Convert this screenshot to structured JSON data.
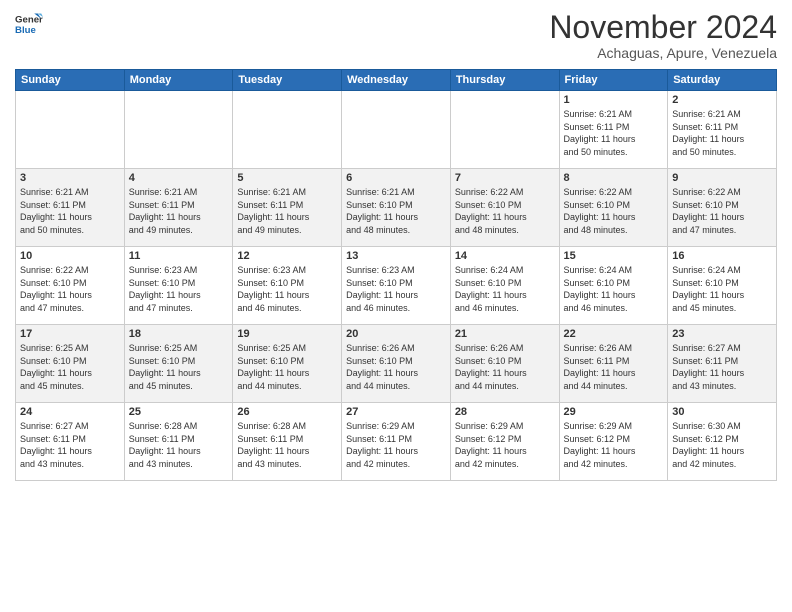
{
  "logo": {
    "line1": "General",
    "line2": "Blue"
  },
  "title": "November 2024",
  "location": "Achaguas, Apure, Venezuela",
  "days_header": [
    "Sunday",
    "Monday",
    "Tuesday",
    "Wednesday",
    "Thursday",
    "Friday",
    "Saturday"
  ],
  "weeks": [
    [
      {
        "day": "",
        "info": ""
      },
      {
        "day": "",
        "info": ""
      },
      {
        "day": "",
        "info": ""
      },
      {
        "day": "",
        "info": ""
      },
      {
        "day": "",
        "info": ""
      },
      {
        "day": "1",
        "info": "Sunrise: 6:21 AM\nSunset: 6:11 PM\nDaylight: 11 hours\nand 50 minutes."
      },
      {
        "day": "2",
        "info": "Sunrise: 6:21 AM\nSunset: 6:11 PM\nDaylight: 11 hours\nand 50 minutes."
      }
    ],
    [
      {
        "day": "3",
        "info": "Sunrise: 6:21 AM\nSunset: 6:11 PM\nDaylight: 11 hours\nand 50 minutes."
      },
      {
        "day": "4",
        "info": "Sunrise: 6:21 AM\nSunset: 6:11 PM\nDaylight: 11 hours\nand 49 minutes."
      },
      {
        "day": "5",
        "info": "Sunrise: 6:21 AM\nSunset: 6:11 PM\nDaylight: 11 hours\nand 49 minutes."
      },
      {
        "day": "6",
        "info": "Sunrise: 6:21 AM\nSunset: 6:10 PM\nDaylight: 11 hours\nand 48 minutes."
      },
      {
        "day": "7",
        "info": "Sunrise: 6:22 AM\nSunset: 6:10 PM\nDaylight: 11 hours\nand 48 minutes."
      },
      {
        "day": "8",
        "info": "Sunrise: 6:22 AM\nSunset: 6:10 PM\nDaylight: 11 hours\nand 48 minutes."
      },
      {
        "day": "9",
        "info": "Sunrise: 6:22 AM\nSunset: 6:10 PM\nDaylight: 11 hours\nand 47 minutes."
      }
    ],
    [
      {
        "day": "10",
        "info": "Sunrise: 6:22 AM\nSunset: 6:10 PM\nDaylight: 11 hours\nand 47 minutes."
      },
      {
        "day": "11",
        "info": "Sunrise: 6:23 AM\nSunset: 6:10 PM\nDaylight: 11 hours\nand 47 minutes."
      },
      {
        "day": "12",
        "info": "Sunrise: 6:23 AM\nSunset: 6:10 PM\nDaylight: 11 hours\nand 46 minutes."
      },
      {
        "day": "13",
        "info": "Sunrise: 6:23 AM\nSunset: 6:10 PM\nDaylight: 11 hours\nand 46 minutes."
      },
      {
        "day": "14",
        "info": "Sunrise: 6:24 AM\nSunset: 6:10 PM\nDaylight: 11 hours\nand 46 minutes."
      },
      {
        "day": "15",
        "info": "Sunrise: 6:24 AM\nSunset: 6:10 PM\nDaylight: 11 hours\nand 46 minutes."
      },
      {
        "day": "16",
        "info": "Sunrise: 6:24 AM\nSunset: 6:10 PM\nDaylight: 11 hours\nand 45 minutes."
      }
    ],
    [
      {
        "day": "17",
        "info": "Sunrise: 6:25 AM\nSunset: 6:10 PM\nDaylight: 11 hours\nand 45 minutes."
      },
      {
        "day": "18",
        "info": "Sunrise: 6:25 AM\nSunset: 6:10 PM\nDaylight: 11 hours\nand 45 minutes."
      },
      {
        "day": "19",
        "info": "Sunrise: 6:25 AM\nSunset: 6:10 PM\nDaylight: 11 hours\nand 44 minutes."
      },
      {
        "day": "20",
        "info": "Sunrise: 6:26 AM\nSunset: 6:10 PM\nDaylight: 11 hours\nand 44 minutes."
      },
      {
        "day": "21",
        "info": "Sunrise: 6:26 AM\nSunset: 6:10 PM\nDaylight: 11 hours\nand 44 minutes."
      },
      {
        "day": "22",
        "info": "Sunrise: 6:26 AM\nSunset: 6:11 PM\nDaylight: 11 hours\nand 44 minutes."
      },
      {
        "day": "23",
        "info": "Sunrise: 6:27 AM\nSunset: 6:11 PM\nDaylight: 11 hours\nand 43 minutes."
      }
    ],
    [
      {
        "day": "24",
        "info": "Sunrise: 6:27 AM\nSunset: 6:11 PM\nDaylight: 11 hours\nand 43 minutes."
      },
      {
        "day": "25",
        "info": "Sunrise: 6:28 AM\nSunset: 6:11 PM\nDaylight: 11 hours\nand 43 minutes."
      },
      {
        "day": "26",
        "info": "Sunrise: 6:28 AM\nSunset: 6:11 PM\nDaylight: 11 hours\nand 43 minutes."
      },
      {
        "day": "27",
        "info": "Sunrise: 6:29 AM\nSunset: 6:11 PM\nDaylight: 11 hours\nand 42 minutes."
      },
      {
        "day": "28",
        "info": "Sunrise: 6:29 AM\nSunset: 6:12 PM\nDaylight: 11 hours\nand 42 minutes."
      },
      {
        "day": "29",
        "info": "Sunrise: 6:29 AM\nSunset: 6:12 PM\nDaylight: 11 hours\nand 42 minutes."
      },
      {
        "day": "30",
        "info": "Sunrise: 6:30 AM\nSunset: 6:12 PM\nDaylight: 11 hours\nand 42 minutes."
      }
    ]
  ]
}
